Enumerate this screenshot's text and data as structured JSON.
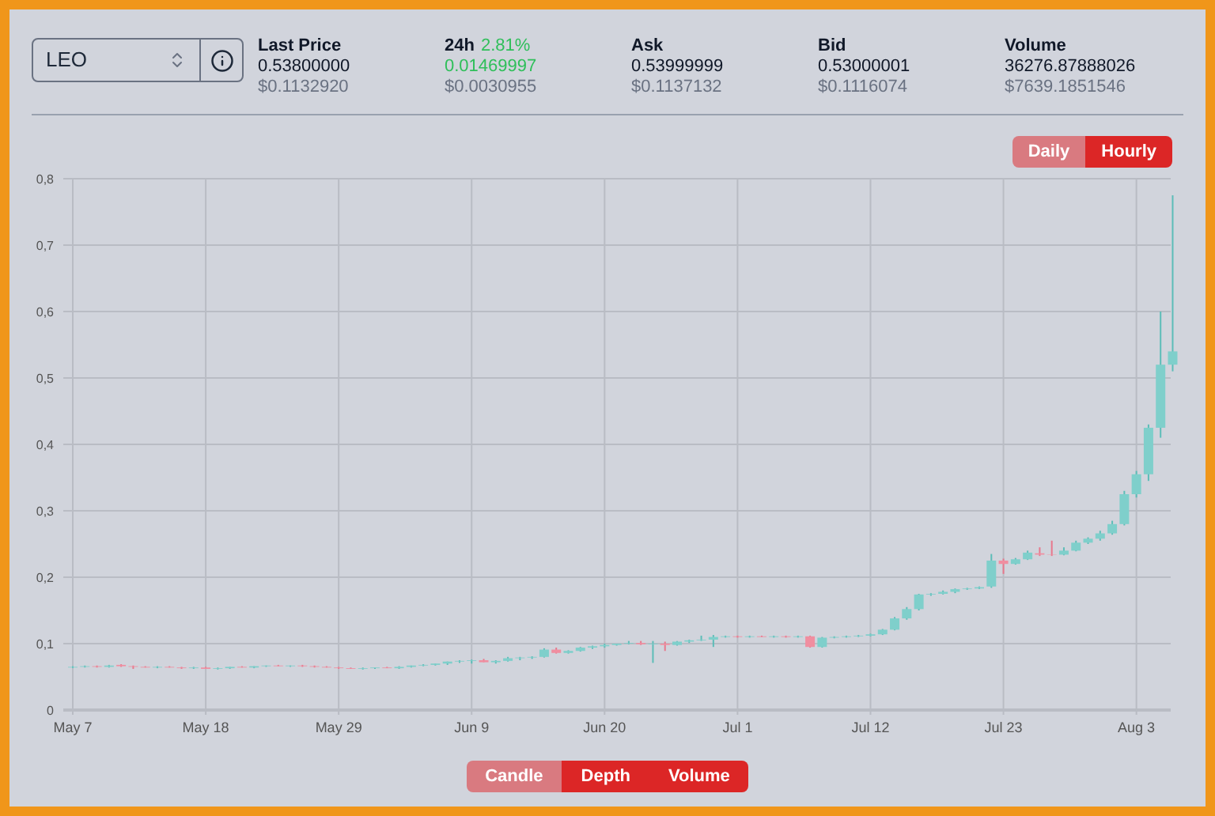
{
  "market_select": {
    "value": "LEO"
  },
  "stats": [
    {
      "label": "Last Price",
      "kind": "price",
      "value": "0.53800000",
      "usd": "$0.1132920"
    },
    {
      "label": "24h",
      "change": "2.81%",
      "kind": "change",
      "value": "0.01469997",
      "usd": "$0.0030955"
    },
    {
      "label": "Ask",
      "kind": "price",
      "value": "0.53999999",
      "usd": "$0.1137132"
    },
    {
      "label": "Bid",
      "kind": "price",
      "value": "0.53000001",
      "usd": "$0.1116074"
    },
    {
      "label": "Volume",
      "kind": "price",
      "value": "36276.87888026",
      "usd": "$7639.1851546"
    }
  ],
  "intervals": [
    {
      "label": "Daily",
      "selected": true
    },
    {
      "label": "Hourly",
      "selected": false
    }
  ],
  "chart": {
    "chart_data": {
      "type": "candlestick",
      "categories": [
        "May 7",
        null,
        null,
        null,
        null,
        null,
        null,
        null,
        null,
        null,
        null,
        "May 18",
        null,
        null,
        null,
        null,
        null,
        null,
        null,
        null,
        null,
        null,
        "May 29",
        null,
        null,
        null,
        null,
        null,
        null,
        null,
        null,
        null,
        null,
        "Jun 9",
        null,
        null,
        null,
        null,
        null,
        null,
        null,
        null,
        null,
        null,
        "Jun 20",
        null,
        null,
        null,
        null,
        null,
        null,
        null,
        null,
        null,
        null,
        "Jul 1",
        null,
        null,
        null,
        null,
        null,
        null,
        null,
        null,
        null,
        null,
        "Jul 12",
        null,
        null,
        null,
        null,
        null,
        null,
        null,
        null,
        null,
        null,
        "Jul 23",
        null,
        null,
        null,
        null,
        null,
        null,
        null,
        null,
        null,
        null,
        "Aug 3",
        null,
        null,
        null
      ],
      "ylim": [
        0,
        0.8
      ],
      "grid": true,
      "yticks": [
        {
          "value": 0.8,
          "label": "0,8"
        },
        {
          "value": 0.7,
          "label": "0,7"
        },
        {
          "value": 0.6,
          "label": "0,6"
        },
        {
          "value": 0.5,
          "label": "0,5"
        },
        {
          "value": 0.4,
          "label": "0,4"
        },
        {
          "value": 0.3,
          "label": "0,3"
        },
        {
          "value": 0.2,
          "label": "0,2"
        },
        {
          "value": 0.1,
          "label": "0,1"
        },
        {
          "value": 0,
          "label": "0"
        }
      ],
      "ohlc": [
        [
          0.064,
          0.066,
          0.063,
          0.065
        ],
        [
          0.065,
          0.067,
          0.064,
          0.066
        ],
        [
          0.066,
          0.067,
          0.064,
          0.065
        ],
        [
          0.065,
          0.068,
          0.064,
          0.067
        ],
        [
          0.068,
          0.069,
          0.065,
          0.066
        ],
        [
          0.066,
          0.067,
          0.062,
          0.065
        ],
        [
          0.065,
          0.066,
          0.064,
          0.064
        ],
        [
          0.064,
          0.066,
          0.063,
          0.065
        ],
        [
          0.065,
          0.066,
          0.064,
          0.064
        ],
        [
          0.064,
          0.065,
          0.062,
          0.063
        ],
        [
          0.063,
          0.065,
          0.062,
          0.064
        ],
        [
          0.064,
          0.065,
          0.062,
          0.062
        ],
        [
          0.062,
          0.064,
          0.061,
          0.063
        ],
        [
          0.063,
          0.065,
          0.062,
          0.065
        ],
        [
          0.065,
          0.066,
          0.064,
          0.064
        ],
        [
          0.064,
          0.066,
          0.063,
          0.066
        ],
        [
          0.066,
          0.067,
          0.065,
          0.067
        ],
        [
          0.067,
          0.068,
          0.066,
          0.066
        ],
        [
          0.066,
          0.067,
          0.065,
          0.067
        ],
        [
          0.067,
          0.068,
          0.065,
          0.066
        ],
        [
          0.066,
          0.067,
          0.064,
          0.065
        ],
        [
          0.065,
          0.066,
          0.064,
          0.064
        ],
        [
          0.064,
          0.065,
          0.062,
          0.063
        ],
        [
          0.063,
          0.064,
          0.062,
          0.062
        ],
        [
          0.062,
          0.064,
          0.061,
          0.063
        ],
        [
          0.063,
          0.064,
          0.062,
          0.064
        ],
        [
          0.064,
          0.065,
          0.063,
          0.063
        ],
        [
          0.063,
          0.066,
          0.062,
          0.065
        ],
        [
          0.065,
          0.067,
          0.064,
          0.067
        ],
        [
          0.067,
          0.069,
          0.066,
          0.068
        ],
        [
          0.068,
          0.07,
          0.067,
          0.07
        ],
        [
          0.07,
          0.073,
          0.068,
          0.073
        ],
        [
          0.073,
          0.075,
          0.071,
          0.074
        ],
        [
          0.074,
          0.076,
          0.07,
          0.075
        ],
        [
          0.075,
          0.077,
          0.072,
          0.072
        ],
        [
          0.072,
          0.075,
          0.07,
          0.074
        ],
        [
          0.074,
          0.08,
          0.073,
          0.078
        ],
        [
          0.078,
          0.08,
          0.075,
          0.079
        ],
        [
          0.079,
          0.081,
          0.077,
          0.08
        ],
        [
          0.08,
          0.093,
          0.079,
          0.091
        ],
        [
          0.091,
          0.094,
          0.085,
          0.086
        ],
        [
          0.086,
          0.09,
          0.085,
          0.089
        ],
        [
          0.089,
          0.095,
          0.088,
          0.094
        ],
        [
          0.094,
          0.097,
          0.092,
          0.096
        ],
        [
          0.096,
          0.1,
          0.094,
          0.098
        ],
        [
          0.098,
          0.1,
          0.097,
          0.1
        ],
        [
          0.1,
          0.104,
          0.099,
          0.101
        ],
        [
          0.101,
          0.104,
          0.098,
          0.099
        ],
        [
          0.099,
          0.104,
          0.071,
          0.1
        ],
        [
          0.1,
          0.103,
          0.089,
          0.098
        ],
        [
          0.098,
          0.104,
          0.097,
          0.103
        ],
        [
          0.103,
          0.106,
          0.101,
          0.105
        ],
        [
          0.105,
          0.112,
          0.104,
          0.106
        ],
        [
          0.106,
          0.113,
          0.095,
          0.11
        ],
        [
          0.11,
          0.112,
          0.109,
          0.111
        ],
        [
          0.111,
          0.112,
          0.109,
          0.11
        ],
        [
          0.11,
          0.112,
          0.109,
          0.111
        ],
        [
          0.111,
          0.112,
          0.11,
          0.11
        ],
        [
          0.11,
          0.112,
          0.109,
          0.111
        ],
        [
          0.111,
          0.112,
          0.109,
          0.11
        ],
        [
          0.11,
          0.112,
          0.109,
          0.111
        ],
        [
          0.111,
          0.112,
          0.094,
          0.095
        ],
        [
          0.095,
          0.11,
          0.094,
          0.109
        ],
        [
          0.109,
          0.111,
          0.108,
          0.11
        ],
        [
          0.11,
          0.112,
          0.109,
          0.111
        ],
        [
          0.111,
          0.113,
          0.11,
          0.112
        ],
        [
          0.112,
          0.115,
          0.111,
          0.114
        ],
        [
          0.114,
          0.122,
          0.113,
          0.121
        ],
        [
          0.121,
          0.14,
          0.12,
          0.138
        ],
        [
          0.138,
          0.155,
          0.136,
          0.152
        ],
        [
          0.152,
          0.175,
          0.15,
          0.174
        ],
        [
          0.174,
          0.176,
          0.172,
          0.175
        ],
        [
          0.175,
          0.18,
          0.174,
          0.178
        ],
        [
          0.178,
          0.183,
          0.176,
          0.182
        ],
        [
          0.182,
          0.184,
          0.181,
          0.183
        ],
        [
          0.183,
          0.186,
          0.182,
          0.185
        ],
        [
          0.186,
          0.235,
          0.184,
          0.225
        ],
        [
          0.225,
          0.228,
          0.205,
          0.22
        ],
        [
          0.22,
          0.229,
          0.219,
          0.227
        ],
        [
          0.227,
          0.24,
          0.226,
          0.237
        ],
        [
          0.236,
          0.245,
          0.232,
          0.234
        ],
        [
          0.234,
          0.255,
          0.232,
          0.2335
        ],
        [
          0.234,
          0.245,
          0.233,
          0.24
        ],
        [
          0.24,
          0.255,
          0.239,
          0.252
        ],
        [
          0.252,
          0.26,
          0.25,
          0.258
        ],
        [
          0.258,
          0.27,
          0.255,
          0.266
        ],
        [
          0.266,
          0.285,
          0.264,
          0.28
        ],
        [
          0.28,
          0.33,
          0.278,
          0.325
        ],
        [
          0.325,
          0.36,
          0.32,
          0.355
        ],
        [
          0.355,
          0.43,
          0.345,
          0.425
        ],
        [
          0.425,
          0.6,
          0.41,
          0.52
        ],
        [
          0.52,
          0.775,
          0.51,
          0.54
        ]
      ]
    }
  },
  "views": [
    {
      "label": "Candle",
      "selected": true
    },
    {
      "label": "Depth",
      "selected": false
    },
    {
      "label": "Volume",
      "selected": false
    }
  ]
}
